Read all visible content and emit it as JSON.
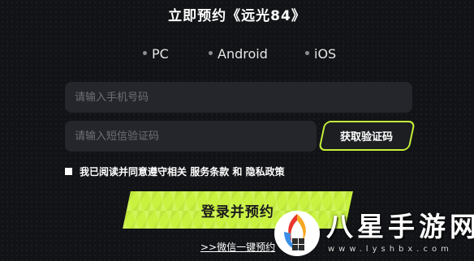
{
  "title": "立即预约《远光84》",
  "platforms": [
    {
      "label": "PC"
    },
    {
      "label": "Android"
    },
    {
      "label": "iOS"
    }
  ],
  "phone_input": {
    "placeholder": "请输入手机号码",
    "value": ""
  },
  "code_input": {
    "placeholder": "请输入短信验证码",
    "value": ""
  },
  "get_code_button": {
    "label": "获取验证码"
  },
  "agreement": {
    "checked": false,
    "prefix": "我已阅读并同意遵守相关 ",
    "terms_link": "服务条款",
    "connector": " 和 ",
    "privacy_link": "隐私政策"
  },
  "submit_button": {
    "label": "登录并预约"
  },
  "wechat_link": {
    "label": ">>微信一键预约"
  },
  "watermark": {
    "name": "八星手游网",
    "url": "www.lyshbx.com"
  },
  "colors": {
    "background": "#121316",
    "accent": "#c8f23f",
    "input_bg": "#25262b"
  }
}
